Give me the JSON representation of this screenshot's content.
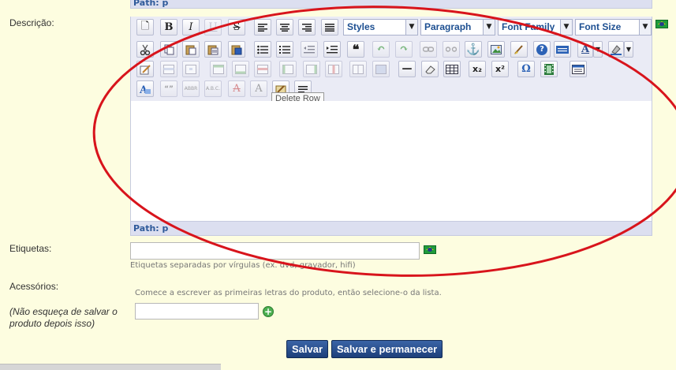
{
  "form": {
    "description_label": "Descrição:",
    "tags_label": "Etiquetas:",
    "tags_value": "",
    "tags_hint": "Etiquetas separadas por vírgulas (ex. dvd, gravador, hifi)",
    "accessories_label": "Acessórios:",
    "accessories_hint": "Comece a escrever as primeiras letras do produto, então selecione-o da lista.",
    "accessories_note": "(Não esqueça de salvar o produto depois isso)",
    "accessories_value": ""
  },
  "editor": {
    "path_top": "Path: p",
    "path_bottom": "Path: p",
    "styles_label": "Styles",
    "paragraph_label": "Paragraph",
    "font_family_label": "Font Family",
    "font_size_label": "Font Size",
    "tooltip": "Delete Row",
    "glyphs": {
      "new": "🗋",
      "bold": "B",
      "italic": "I",
      "underline": "U",
      "strike": "S",
      "quote": "❝",
      "undo": "↶",
      "redo": "↷",
      "anchor": "⚓",
      "help": "?",
      "font_color": "A",
      "hr": "—",
      "sub": "x₂",
      "sup": "x²",
      "omega": "Ω",
      "text_a": "A",
      "dropdown": "▼"
    }
  },
  "buttons": {
    "save": "Salvar",
    "save_stay": "Salvar e permanecer"
  },
  "colors": {
    "background": "#fdfde0",
    "accent": "#1d3f7a",
    "annotation": "#d8141c"
  }
}
